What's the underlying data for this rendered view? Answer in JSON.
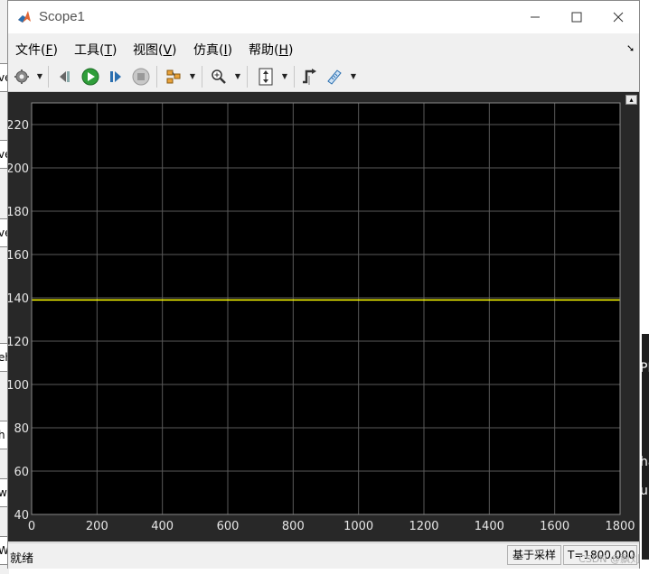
{
  "window": {
    "title": "Scope1"
  },
  "menu": {
    "items": [
      {
        "label": "文件(",
        "accel": "F",
        "tail": ")"
      },
      {
        "label": "工具(",
        "accel": "T",
        "tail": ")"
      },
      {
        "label": "视图(",
        "accel": "V",
        "tail": ")"
      },
      {
        "label": "仿真(",
        "accel": "I",
        "tail": ")"
      },
      {
        "label": "帮助(",
        "accel": "H",
        "tail": ")"
      }
    ]
  },
  "toolbar": {
    "icons": [
      "gear-icon",
      "step-back-icon",
      "run-icon",
      "step-forward-icon",
      "stop-icon",
      "signal-layout-icon",
      "zoom-in-icon",
      "autoscale-icon",
      "triggers-icon",
      "measurements-icon"
    ]
  },
  "background": {
    "left_fragments": [
      "ve",
      "ve",
      "ve",
      "eh",
      "h",
      "w",
      "W"
    ],
    "right_fragments": [
      "PE",
      "ha",
      "u"
    ],
    "watermark": "CSDN @飘刘"
  },
  "status": {
    "text": "就绪",
    "sample_mode": "基于采样",
    "time": "T=1800.000"
  },
  "colors": {
    "plot_background": "#000000",
    "axes_background": "#282828",
    "grid": "#5a5a5a",
    "trace": "#ffff00",
    "tick_label": "#e6e6e6"
  },
  "chart_data": {
    "type": "line",
    "title": "",
    "xlabel": "",
    "ylabel": "",
    "xlim": [
      0,
      1800
    ],
    "ylim": [
      40,
      230
    ],
    "xticks": [
      0,
      200,
      400,
      600,
      800,
      1000,
      1200,
      1400,
      1600,
      1800
    ],
    "yticks": [
      40,
      60,
      80,
      100,
      120,
      140,
      160,
      180,
      200,
      220
    ],
    "grid": true,
    "series": [
      {
        "x": [
          0,
          1800
        ],
        "y": [
          139,
          139
        ],
        "color": "#ffff00"
      }
    ]
  }
}
